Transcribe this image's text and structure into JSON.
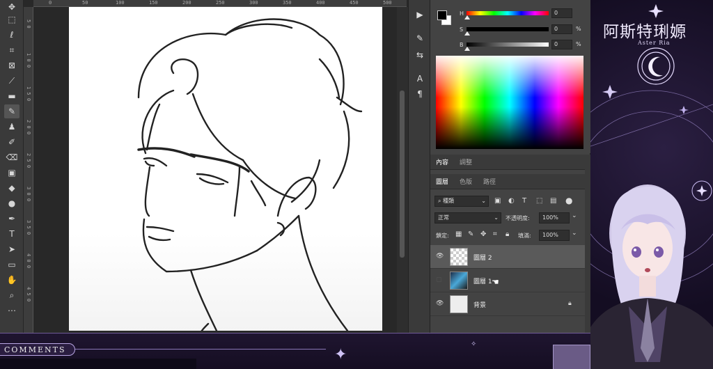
{
  "ruler": {
    "top": [
      "0",
      "50",
      "100",
      "150",
      "200",
      "250",
      "300",
      "350",
      "400",
      "450",
      "500"
    ],
    "left": [
      "5 0",
      "1 0 0",
      "1 5 0",
      "2 0 0",
      "2 5 0",
      "3 0 0",
      "3 5 0",
      "4 0 0",
      "4 5 0"
    ]
  },
  "color_panel": {
    "sliders": [
      {
        "label": "H",
        "value": "0",
        "unit": ""
      },
      {
        "label": "S",
        "value": "0",
        "unit": "%"
      },
      {
        "label": "B",
        "value": "0",
        "unit": "%"
      }
    ],
    "foreground": "#000000",
    "background": "#ffffff"
  },
  "adjust_tabs": {
    "tab1": "內容",
    "tab2": "調整"
  },
  "layer_tabs": {
    "tab1": "圖層",
    "tab2": "色版",
    "tab3": "路徑"
  },
  "layers_panel": {
    "filter_kind": "種類",
    "blend_mode": "正常",
    "opacity_label": "不透明度:",
    "opacity_value": "100%",
    "lock_label": "鎖定:",
    "fill_label": "填滿:",
    "fill_value": "100%",
    "layers": [
      {
        "name": "圖層 2"
      },
      {
        "name": "圖層 1"
      },
      {
        "name": "背景"
      }
    ]
  },
  "overlay": {
    "title": "阿斯特琍嫄",
    "subtitle": "Aster Ria",
    "comments": "COMMENTS"
  }
}
